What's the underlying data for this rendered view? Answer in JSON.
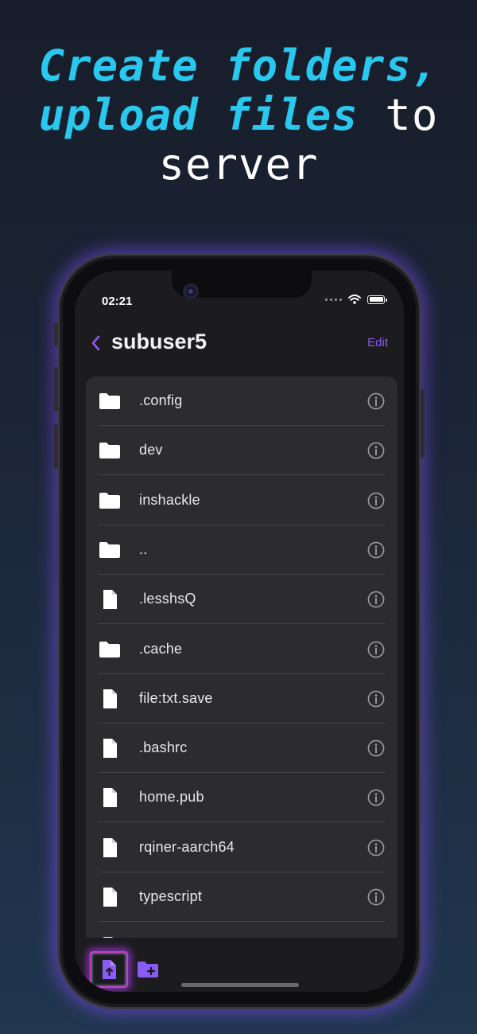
{
  "headline": {
    "line1": "Create folders,",
    "line2_highlight": "upload files",
    "line2_rest": " to",
    "line3": "server"
  },
  "colors": {
    "accent": "#8a5cf6",
    "headline_highlight": "#29c8ee",
    "glow": "#b43cff"
  },
  "status_bar": {
    "time": "02:21",
    "icons": [
      "signal-dots-icon",
      "wifi-icon",
      "battery-icon"
    ]
  },
  "nav": {
    "back_icon": "chevron-left-icon",
    "title": "subuser5",
    "edit_label": "Edit"
  },
  "files": [
    {
      "name": ".config",
      "type": "folder"
    },
    {
      "name": "dev",
      "type": "folder"
    },
    {
      "name": "inshackle",
      "type": "folder"
    },
    {
      "name": "..",
      "type": "folder"
    },
    {
      "name": ".lesshsQ",
      "type": "file"
    },
    {
      "name": ".cache",
      "type": "folder"
    },
    {
      "name": "file:txt.save",
      "type": "file"
    },
    {
      "name": ".bashrc",
      "type": "file"
    },
    {
      "name": "home.pub",
      "type": "file"
    },
    {
      "name": "rqiner-aarch64",
      "type": "file"
    },
    {
      "name": "typescript",
      "type": "file"
    },
    {
      "name": "",
      "type": "file"
    }
  ],
  "toolbar": {
    "upload_icon": "upload-file-icon",
    "new_folder_icon": "new-folder-icon"
  }
}
